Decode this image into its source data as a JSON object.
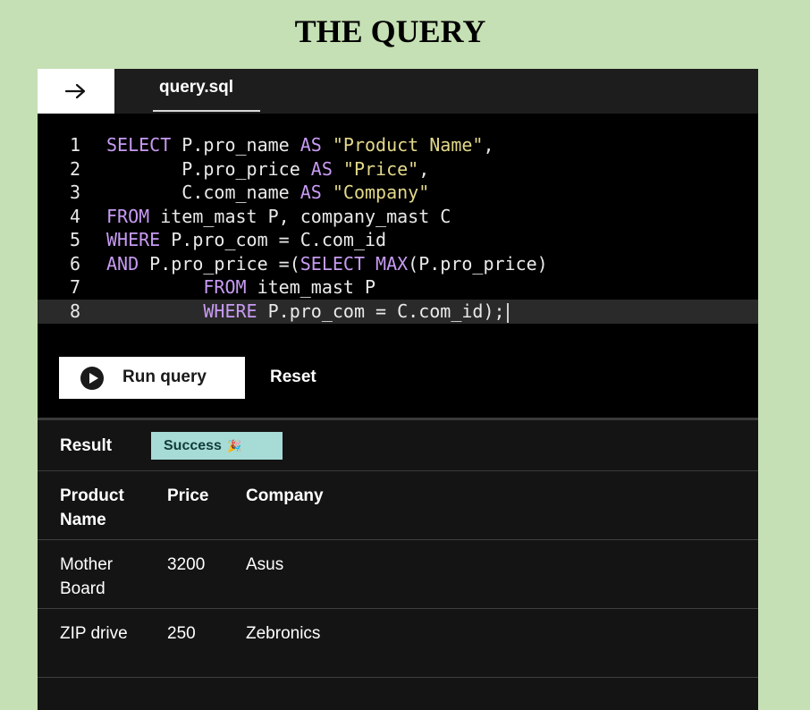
{
  "page_title": "THE QUERY",
  "tab": {
    "label": "query.sql"
  },
  "editor": {
    "lines": [
      {
        "num": "1",
        "tokens": [
          {
            "t": "SELECT ",
            "c": "kw"
          },
          {
            "t": "P.pro_name ",
            "c": "id"
          },
          {
            "t": "AS ",
            "c": "kw"
          },
          {
            "t": "\"Product Name\"",
            "c": "str"
          },
          {
            "t": ",",
            "c": "id"
          }
        ]
      },
      {
        "num": "2",
        "tokens": [
          {
            "t": "       P.pro_price ",
            "c": "id"
          },
          {
            "t": "AS ",
            "c": "kw"
          },
          {
            "t": "\"Price\"",
            "c": "str"
          },
          {
            "t": ",",
            "c": "id"
          }
        ]
      },
      {
        "num": "3",
        "tokens": [
          {
            "t": "       C.com_name ",
            "c": "id"
          },
          {
            "t": "AS ",
            "c": "kw"
          },
          {
            "t": "\"Company\"",
            "c": "str"
          }
        ]
      },
      {
        "num": "4",
        "tokens": [
          {
            "t": "FROM ",
            "c": "kw"
          },
          {
            "t": "item_mast P, company_mast C",
            "c": "id"
          }
        ]
      },
      {
        "num": "5",
        "tokens": [
          {
            "t": "WHERE ",
            "c": "kw"
          },
          {
            "t": "P.pro_com = C.com_id",
            "c": "id"
          }
        ]
      },
      {
        "num": "6",
        "tokens": [
          {
            "t": "AND ",
            "c": "kw"
          },
          {
            "t": "P.pro_price =(",
            "c": "id"
          },
          {
            "t": "SELECT ",
            "c": "kw"
          },
          {
            "t": "MAX",
            "c": "fn"
          },
          {
            "t": "(P.pro_price)",
            "c": "id"
          }
        ]
      },
      {
        "num": "7",
        "tokens": [
          {
            "t": "         ",
            "c": "id"
          },
          {
            "t": "FROM ",
            "c": "kw"
          },
          {
            "t": "item_mast P",
            "c": "id"
          }
        ]
      },
      {
        "num": "8",
        "tokens": [
          {
            "t": "         ",
            "c": "id"
          },
          {
            "t": "WHERE ",
            "c": "kw"
          },
          {
            "t": "P.pro_com = C.com_id);",
            "c": "id"
          }
        ]
      }
    ]
  },
  "actions": {
    "run_label": "Run query",
    "reset_label": "Reset"
  },
  "result": {
    "label": "Result",
    "status": "Success",
    "status_icon": "🎉",
    "columns": [
      "Product Name",
      "Price",
      "Company"
    ],
    "rows": [
      [
        "Mother Board",
        "3200",
        "Asus"
      ],
      [
        "ZIP drive",
        "250",
        "Zebronics"
      ]
    ]
  }
}
